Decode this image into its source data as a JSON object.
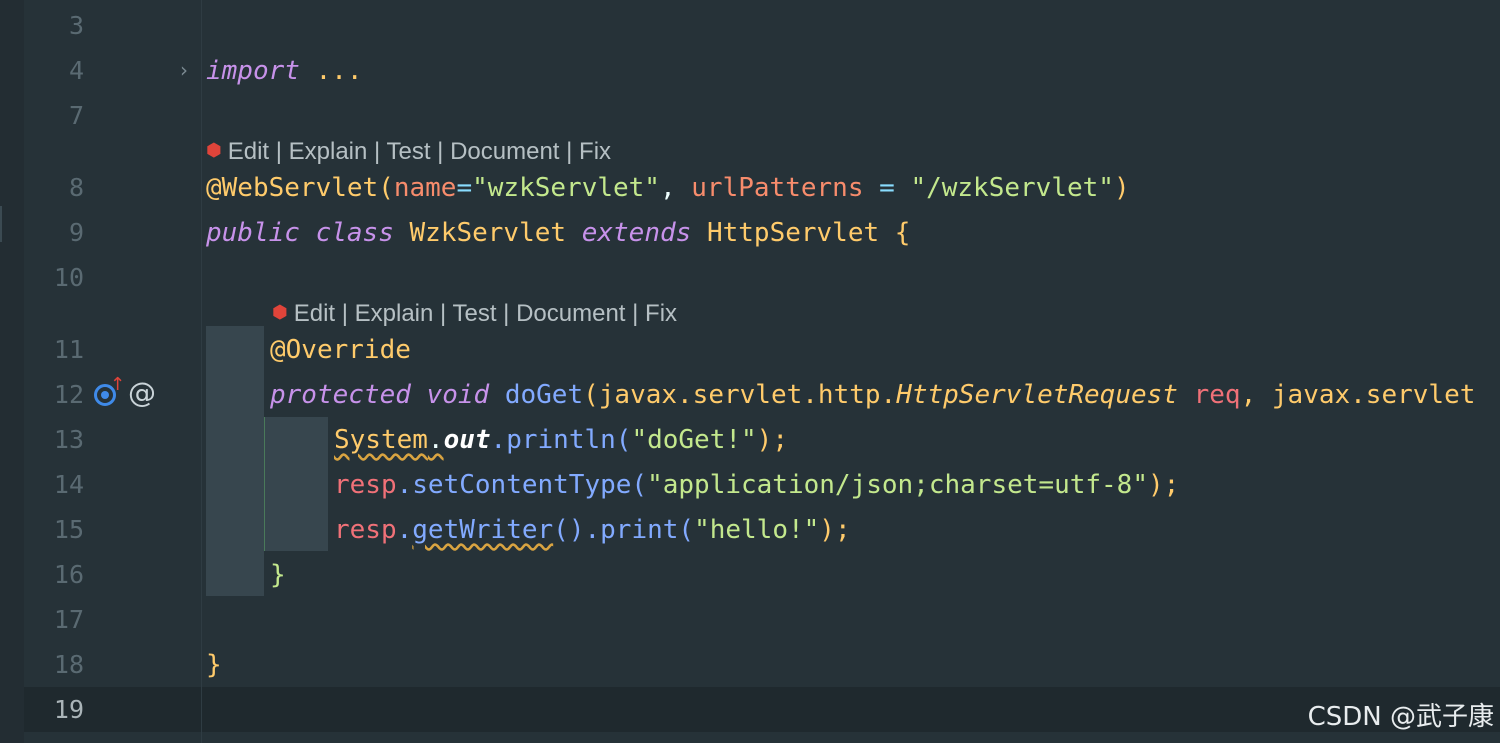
{
  "line_numbers": [
    "3",
    "4",
    "7",
    "8",
    "9",
    "10",
    "11",
    "12",
    "13",
    "14",
    "15",
    "16",
    "17",
    "18",
    "19"
  ],
  "codelens": {
    "class": "Edit | Explain | Test | Document | Fix",
    "method": "Edit | Explain | Test | Document | Fix"
  },
  "code": {
    "l4_kw": "import",
    "l4_dots": " ...",
    "l8_ann": "@WebServlet",
    "l8_p1": "(",
    "l8_name": "name",
    "l8_eq1": "=",
    "l8_s1": "\"wzkServlet\"",
    "l8_comma": ", ",
    "l8_url": "urlPatterns",
    "l8_eq2": " = ",
    "l8_s2": "\"/wzkServlet\"",
    "l8_p2": ")",
    "l9_kw1": "public",
    "l9_kw2": "class",
    "l9_cls": "WzkServlet",
    "l9_kw3": "extends",
    "l9_sup": "HttpServlet",
    "l9_brace": " {",
    "l11_ann": "@Override",
    "l12_kw1": "protected",
    "l12_kw2": "void",
    "l12_fn": "doGet",
    "l12_p": "(",
    "l12_pkg": "javax.servlet.http.",
    "l12_type": "HttpServletRequest",
    "l12_req": "req",
    "l12_tail": ", javax.servlet",
    "l13_sys": "System",
    "l13_dot": ".",
    "l13_out": "out",
    "l13_call": ".println(",
    "l13_str": "\"doGet!\"",
    "l13_end": ");",
    "l14_var": "resp",
    "l14_call": ".setContentType(",
    "l14_str": "\"application/json;charset=utf-8\"",
    "l14_end": ");",
    "l15_var": "resp",
    "l15_dot": ".",
    "l15_fn": "getWriter",
    "l15_call": "().print(",
    "l15_str": "\"hello!\"",
    "l15_end": ");",
    "l16_brace": "}",
    "l18_brace": "}"
  },
  "gutter": {
    "override_icon": "override-method-icon",
    "at_icon": "at-sign-icon"
  },
  "watermark": "CSDN @武子康",
  "colors": {
    "background": "#263238",
    "keyword": "#c792ea",
    "string": "#c3e88d",
    "annotation": "#ffcb6b",
    "function": "#82aaff",
    "parameter": "#f78c6c"
  }
}
